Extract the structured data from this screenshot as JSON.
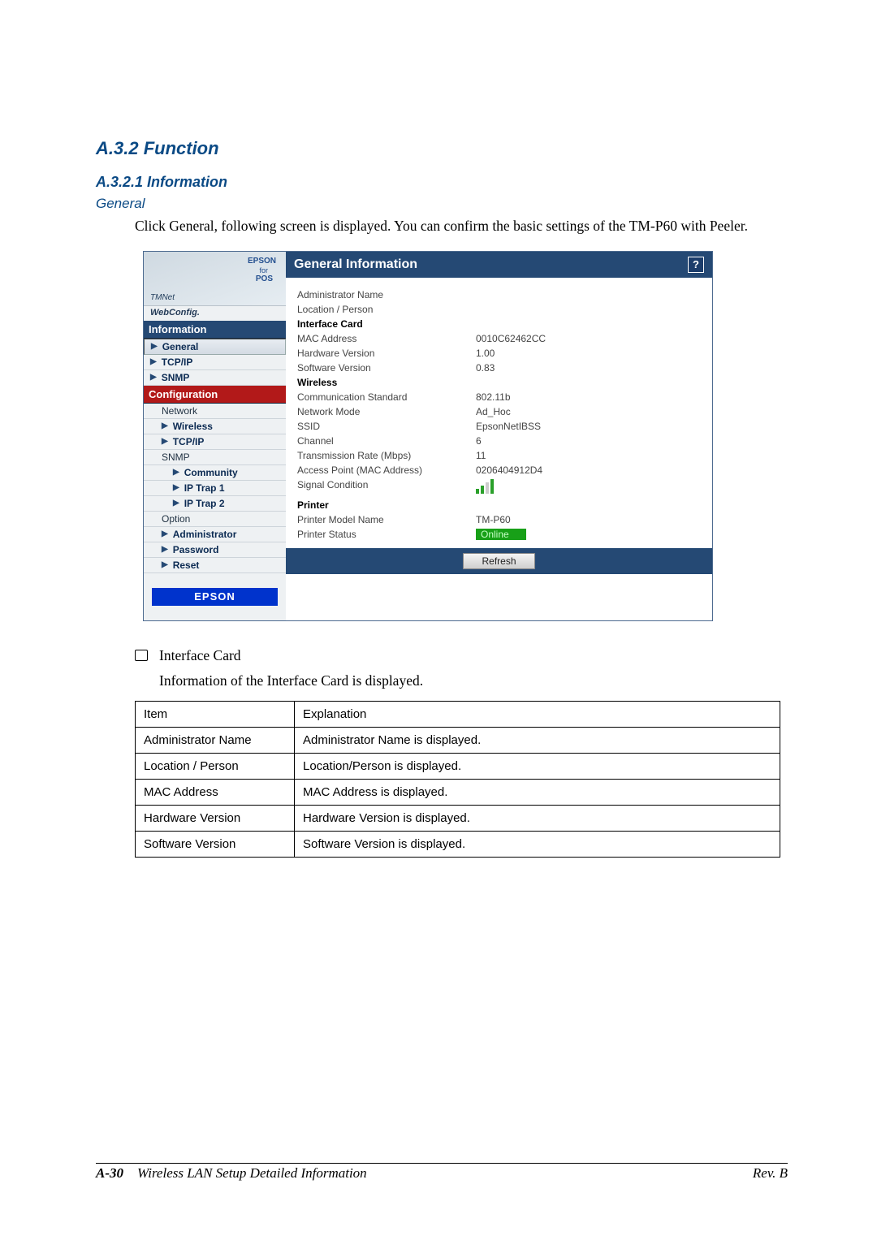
{
  "headings": {
    "section": "A.3.2  Function",
    "subsection": "A.3.2.1  Information",
    "topic": "General"
  },
  "body_intro": "Click General, following screen is displayed. You can confirm the basic settings of the TM-P60 with Peeler.",
  "screenshot": {
    "logo": {
      "brand": "EPSON",
      "for": "for",
      "pos": "POS",
      "tmnet": "TMNet",
      "webconfig": "WebConfig."
    },
    "nav": {
      "information": "Information",
      "general": "General",
      "tcpip": "TCP/IP",
      "snmp": "SNMP",
      "configuration": "Configuration",
      "network": "Network",
      "wireless": "Wireless",
      "tcpip2": "TCP/IP",
      "snmp2": "SNMP",
      "community": "Community",
      "iptrap1": "IP Trap 1",
      "iptrap2": "IP Trap 2",
      "option": "Option",
      "administrator": "Administrator",
      "password": "Password",
      "reset": "Reset",
      "epson": "EPSON"
    },
    "panel_title": "General Information",
    "help": "?",
    "rows": {
      "admin_name": {
        "label": "Administrator Name",
        "value": ""
      },
      "location": {
        "label": "Location / Person",
        "value": ""
      },
      "interface_card": {
        "label": "Interface Card",
        "value": ""
      },
      "mac": {
        "label": "MAC Address",
        "value": "0010C62462CC"
      },
      "hw": {
        "label": "Hardware Version",
        "value": "1.00"
      },
      "sw": {
        "label": "Software Version",
        "value": "0.83"
      },
      "wireless": {
        "label": "Wireless",
        "value": ""
      },
      "std": {
        "label": "Communication Standard",
        "value": "802.11b"
      },
      "mode": {
        "label": "Network Mode",
        "value": "Ad_Hoc"
      },
      "ssid": {
        "label": "SSID",
        "value": "EpsonNetIBSS"
      },
      "channel": {
        "label": "Channel",
        "value": "6"
      },
      "rate": {
        "label": "Transmission Rate (Mbps)",
        "value": "11"
      },
      "ap": {
        "label": "Access Point (MAC Address)",
        "value": "0206404912D4"
      },
      "signal": {
        "label": "Signal Condition"
      },
      "printer": {
        "label": "Printer",
        "value": ""
      },
      "model": {
        "label": "Printer Model Name",
        "value": "TM-P60"
      },
      "status": {
        "label": "Printer Status",
        "value": "Online"
      }
    },
    "refresh": "Refresh"
  },
  "bullet": {
    "title": "Interface Card",
    "desc": "Information of the Interface Card is displayed."
  },
  "table": {
    "header": {
      "col1": "Item",
      "col2": "Explanation"
    },
    "rows": [
      {
        "c1": "Administrator Name",
        "c2": "Administrator Name is displayed."
      },
      {
        "c1": "Location / Person",
        "c2": "Location/Person is displayed."
      },
      {
        "c1": "MAC Address",
        "c2": "MAC Address is displayed."
      },
      {
        "c1": "Hardware Version",
        "c2": "Hardware Version is displayed."
      },
      {
        "c1": "Software Version",
        "c2": "Software Version is displayed."
      }
    ]
  },
  "footer": {
    "page": "A-30",
    "title": "Wireless LAN Setup Detailed Information",
    "rev": "Rev. B"
  }
}
